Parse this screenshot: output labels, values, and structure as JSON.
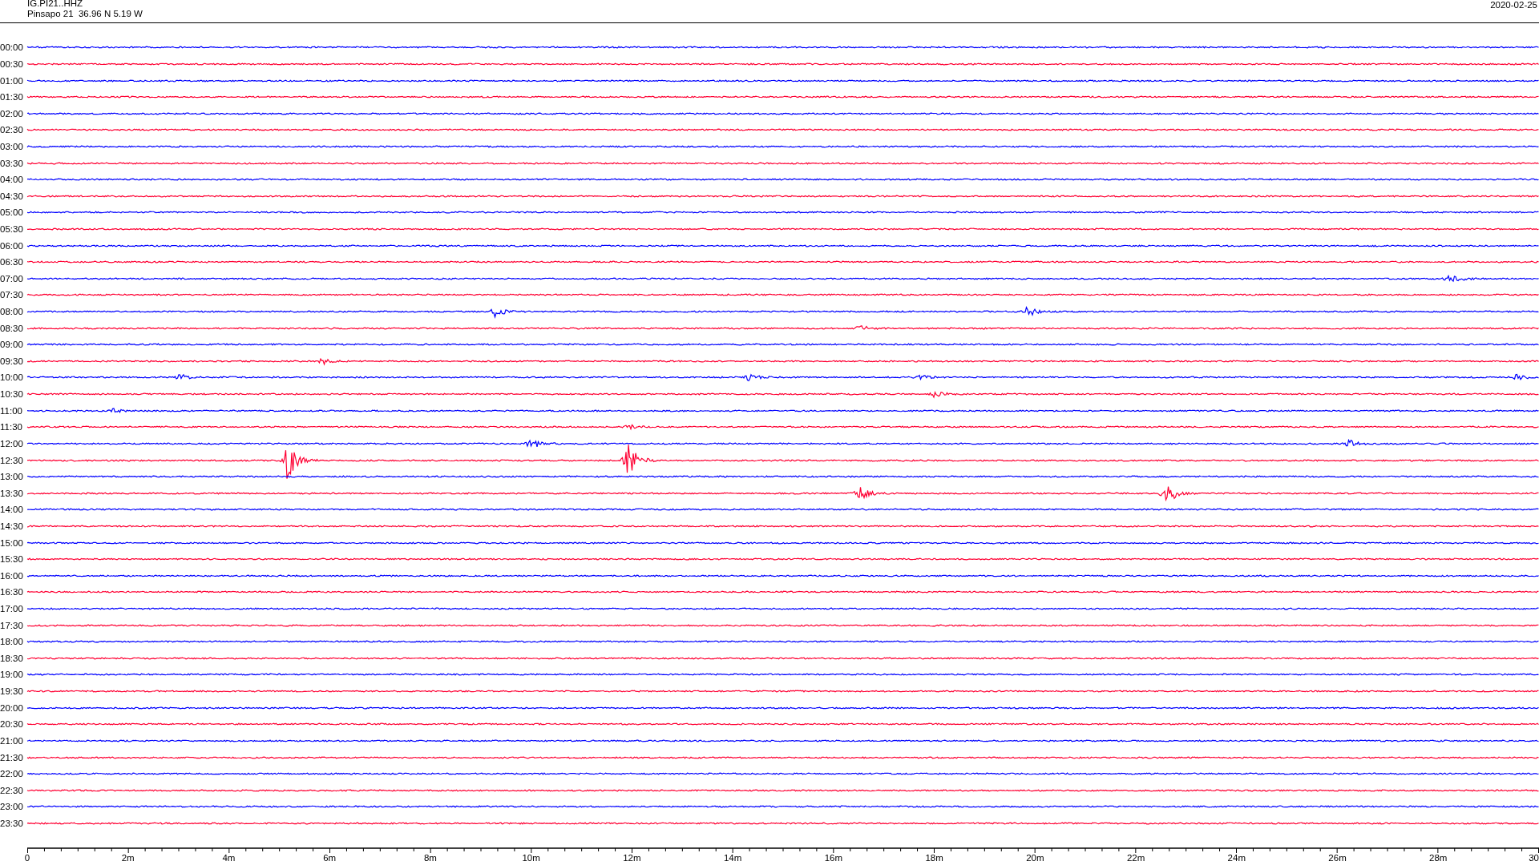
{
  "header": {
    "station_code": "IG.PI21..HHZ",
    "station_location": "Pinsapo 21  36.96 N 5.19 W",
    "date": "2020-02-25"
  },
  "rows": [
    {
      "time": "00:00",
      "color": "#0000ff"
    },
    {
      "time": "00:30",
      "color": "#ff0033"
    },
    {
      "time": "01:00",
      "color": "#0000ff"
    },
    {
      "time": "01:30",
      "color": "#ff0033"
    },
    {
      "time": "02:00",
      "color": "#0000ff"
    },
    {
      "time": "02:30",
      "color": "#ff0033"
    },
    {
      "time": "03:00",
      "color": "#0000ff"
    },
    {
      "time": "03:30",
      "color": "#ff0033"
    },
    {
      "time": "04:00",
      "color": "#0000ff"
    },
    {
      "time": "04:30",
      "color": "#ff0033"
    },
    {
      "time": "05:00",
      "color": "#0000ff"
    },
    {
      "time": "05:30",
      "color": "#ff0033"
    },
    {
      "time": "06:00",
      "color": "#0000ff"
    },
    {
      "time": "06:30",
      "color": "#ff0033"
    },
    {
      "time": "07:00",
      "color": "#0000ff"
    },
    {
      "time": "07:30",
      "color": "#ff0033"
    },
    {
      "time": "08:00",
      "color": "#0000ff"
    },
    {
      "time": "08:30",
      "color": "#ff0033"
    },
    {
      "time": "09:00",
      "color": "#0000ff"
    },
    {
      "time": "09:30",
      "color": "#ff0033"
    },
    {
      "time": "10:00",
      "color": "#0000ff"
    },
    {
      "time": "10:30",
      "color": "#ff0033"
    },
    {
      "time": "11:00",
      "color": "#0000ff"
    },
    {
      "time": "11:30",
      "color": "#ff0033"
    },
    {
      "time": "12:00",
      "color": "#0000ff"
    },
    {
      "time": "12:30",
      "color": "#ff0033"
    },
    {
      "time": "13:00",
      "color": "#0000ff"
    },
    {
      "time": "13:30",
      "color": "#ff0033"
    },
    {
      "time": "14:00",
      "color": "#0000ff"
    },
    {
      "time": "14:30",
      "color": "#ff0033"
    },
    {
      "time": "15:00",
      "color": "#0000ff"
    },
    {
      "time": "15:30",
      "color": "#ff0033"
    },
    {
      "time": "16:00",
      "color": "#0000ff"
    },
    {
      "time": "16:30",
      "color": "#ff0033"
    },
    {
      "time": "17:00",
      "color": "#0000ff"
    },
    {
      "time": "17:30",
      "color": "#ff0033"
    },
    {
      "time": "18:00",
      "color": "#0000ff"
    },
    {
      "time": "18:30",
      "color": "#ff0033"
    },
    {
      "time": "19:00",
      "color": "#0000ff"
    },
    {
      "time": "19:30",
      "color": "#ff0033"
    },
    {
      "time": "20:00",
      "color": "#0000ff"
    },
    {
      "time": "20:30",
      "color": "#ff0033"
    },
    {
      "time": "21:00",
      "color": "#0000ff"
    },
    {
      "time": "21:30",
      "color": "#ff0033"
    },
    {
      "time": "22:00",
      "color": "#0000ff"
    },
    {
      "time": "22:30",
      "color": "#ff0033"
    },
    {
      "time": "23:00",
      "color": "#0000ff"
    },
    {
      "time": "23:30",
      "color": "#ff0033"
    }
  ],
  "time_axis": {
    "labels": [
      "0",
      "2m",
      "4m",
      "6m",
      "8m",
      "10m",
      "12m",
      "14m",
      "16m",
      "18m",
      "20m",
      "22m",
      "24m",
      "26m",
      "28m",
      "30"
    ]
  }
}
